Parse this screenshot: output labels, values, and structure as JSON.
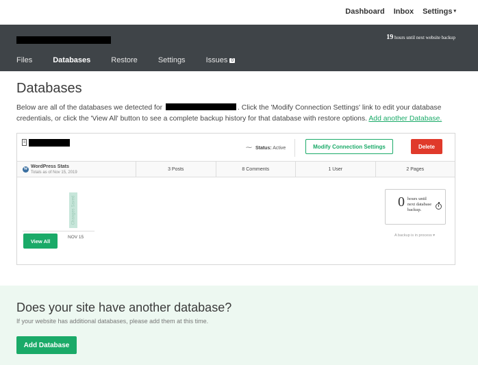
{
  "topnav": {
    "dashboard": "Dashboard",
    "inbox": "Inbox",
    "settings": "Settings",
    "settings_caret": "▾"
  },
  "header": {
    "backup_hours": "19",
    "backup_text": "hours until next website backup"
  },
  "tabs": [
    {
      "label": "Files"
    },
    {
      "label": "Databases",
      "active": true
    },
    {
      "label": "Restore"
    },
    {
      "label": "Settings"
    },
    {
      "label": "Issues",
      "badge": "0"
    }
  ],
  "main": {
    "title": "Databases",
    "intro_before": "Below are all of the databases we detected for",
    "intro_after": ". Click the 'Modify Connection Settings' link to edit your database credentials, or click the 'View All' button to see a complete backup history for that database with restore options.",
    "add_link": "Add another Database."
  },
  "card": {
    "status_label": "Status:",
    "status_value": "Active",
    "modify_button": "Modify Connection Settings",
    "delete_button": "Delete",
    "stats_title": "WordPress Stats",
    "stats_sub": "Totals as of Nov 15, 2019",
    "stats": [
      "3 Posts",
      "8 Comments",
      "1 User",
      "2 Pages"
    ],
    "bar_label": "Changes Saved",
    "x_label": "NOV 15",
    "view_all": "View All",
    "next_num": "0",
    "next_text": "hours until next database backup.",
    "process_text": "A backup is in process ▾"
  },
  "lower": {
    "heading": "Does your site have another database?",
    "sub": "If your website has additional databases, please add them at this time.",
    "button": "Add Database"
  },
  "colors": {
    "accent": "#1aaa68",
    "danger": "#e03a2b",
    "header_bg": "#3f4448",
    "lower_bg": "#edf8f1"
  }
}
